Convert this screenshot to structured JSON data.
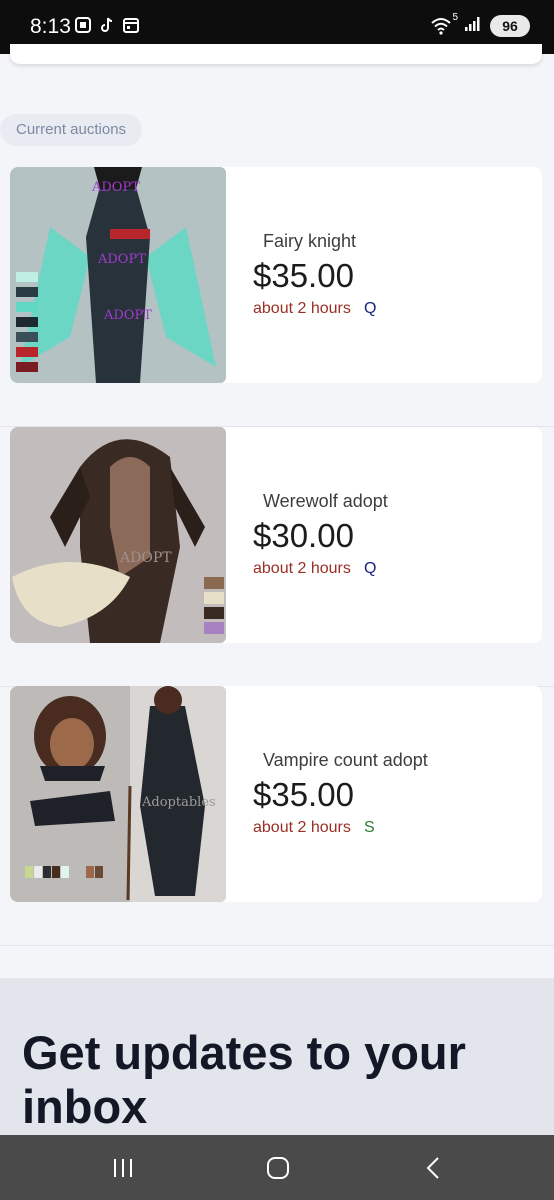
{
  "status_bar": {
    "time": "8:13",
    "network": "5",
    "battery": "96",
    "icons_left": [
      "screenshot-icon",
      "tiktok-icon",
      "calendar-icon"
    ],
    "icons_right": [
      "wifi-icon",
      "signal-icon",
      "battery-icon"
    ]
  },
  "section_label": "Current auctions",
  "auctions": [
    {
      "title": "Fairy knight",
      "price": "$35.00",
      "time_left": "about 2 hours",
      "letter": "Q",
      "letter_color": "#1a237e",
      "image": "fairy-knight-artwork"
    },
    {
      "title": "Werewolf adopt",
      "price": "$30.00",
      "time_left": "about 2 hours",
      "letter": "Q",
      "letter_color": "#1a237e",
      "image": "werewolf-artwork"
    },
    {
      "title": "Vampire count adopt",
      "price": "$35.00",
      "time_left": "about 2 hours",
      "letter": "S",
      "letter_color": "#2e7d32",
      "image": "vampire-count-artwork"
    }
  ],
  "newsletter": {
    "heading": "Get updates to your inbox"
  },
  "watermarks": {
    "adopt": "ADOPT",
    "adoptables": "Adoptables"
  },
  "nav": [
    "recent-apps-icon",
    "home-icon",
    "back-icon"
  ],
  "colors": {
    "status_bar": "#0d0d0d",
    "page_background": "#f4f5f8",
    "price": "#1c1c1c",
    "time_left": "#9a2f24",
    "newsletter_background": "#e2e5ec",
    "nav_bar": "#4a4a4a"
  }
}
